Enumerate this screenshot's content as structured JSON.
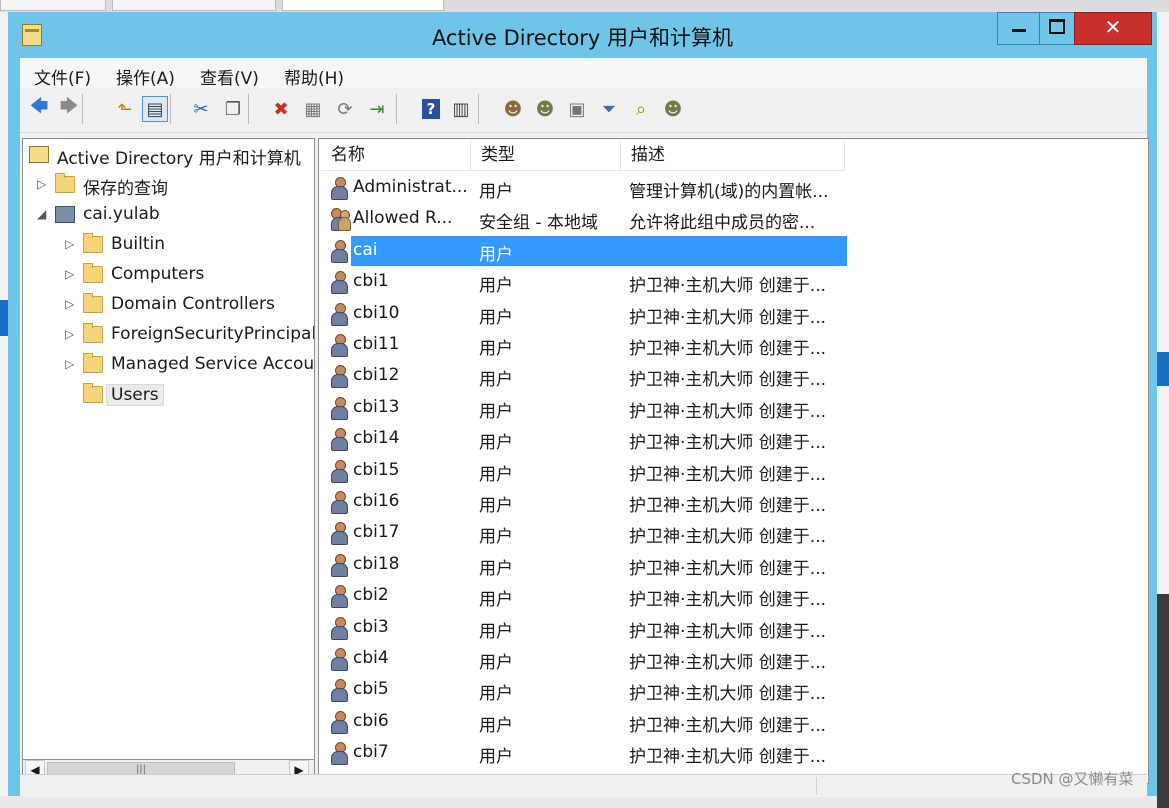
{
  "window": {
    "title": "Active Directory 用户和计算机"
  },
  "menu": [
    "文件(F)",
    "操作(A)",
    "查看(V)",
    "帮助(H)"
  ],
  "toolbar": [
    {
      "icon": "back-arrow-icon",
      "glyph": "🡄",
      "color": "#2f7ad6"
    },
    {
      "icon": "forward-arrow-icon",
      "glyph": "🡆",
      "color": "#8a8a8a"
    },
    {
      "icon": "up-folder-icon",
      "glyph": "⬑",
      "color": "#b58a1b"
    },
    {
      "icon": "show-hide-console-tree-icon",
      "glyph": "▤",
      "color": "#444"
    },
    {
      "icon": "cut-icon",
      "glyph": "✂",
      "color": "#2d5fa8"
    },
    {
      "icon": "copy-icon",
      "glyph": "❐",
      "color": "#555"
    },
    {
      "icon": "delete-icon",
      "glyph": "✖",
      "color": "#d12b1f"
    },
    {
      "icon": "properties-icon",
      "glyph": "▦",
      "color": "#777"
    },
    {
      "icon": "refresh-icon",
      "glyph": "⟳",
      "color": "#777"
    },
    {
      "icon": "export-list-icon",
      "glyph": "⇥",
      "color": "#3a8a2e"
    },
    {
      "icon": "help-icon",
      "glyph": "?",
      "color": "#2b4fa0"
    },
    {
      "icon": "action-pane-icon",
      "glyph": "▥",
      "color": "#444"
    },
    {
      "icon": "new-user-icon",
      "glyph": "☻",
      "color": "#8a6a3a"
    },
    {
      "icon": "new-group-icon",
      "glyph": "☻",
      "color": "#6c7d48"
    },
    {
      "icon": "new-ou-icon",
      "glyph": "▣",
      "color": "#777"
    },
    {
      "icon": "filter-icon",
      "glyph": "⏷",
      "color": "#3a6ea5"
    },
    {
      "icon": "find-icon",
      "glyph": "⌕",
      "color": "#b58a1b"
    },
    {
      "icon": "add-to-group-icon",
      "glyph": "☻",
      "color": "#6c7d48"
    }
  ],
  "tree": [
    {
      "label": "Active Directory 用户和计算机",
      "level": 0,
      "expander": "",
      "icon": "ad-root-icon"
    },
    {
      "label": "保存的查询",
      "level": 1,
      "expander": "▷",
      "icon": "folder-icon"
    },
    {
      "label": "cai.yulab",
      "level": 1,
      "expander": "◢",
      "icon": "domain-icon"
    },
    {
      "label": "Builtin",
      "level": 2,
      "expander": "▷",
      "icon": "folder-icon"
    },
    {
      "label": "Computers",
      "level": 2,
      "expander": "▷",
      "icon": "folder-icon"
    },
    {
      "label": "Domain Controllers",
      "level": 2,
      "expander": "▷",
      "icon": "folder-icon"
    },
    {
      "label": "ForeignSecurityPrincipals",
      "level": 2,
      "expander": "▷",
      "icon": "folder-icon"
    },
    {
      "label": "Managed Service Accounts",
      "level": 2,
      "expander": "▷",
      "icon": "folder-icon"
    },
    {
      "label": "Users",
      "level": 2,
      "expander": "",
      "icon": "folder-icon",
      "selected": true
    }
  ],
  "list": {
    "columns": [
      "名称",
      "类型",
      "描述"
    ],
    "rows": [
      {
        "name": "Administrat...",
        "type": "用户",
        "desc": "管理计算机(域)的内置帐...",
        "icon": "user-icon"
      },
      {
        "name": "Allowed R...",
        "type": "安全组 - 本地域",
        "desc": "允许将此组中成员的密...",
        "icon": "group-icon"
      },
      {
        "name": "cai",
        "type": "用户",
        "desc": "",
        "icon": "user-icon",
        "selected": true
      },
      {
        "name": "cbi1",
        "type": "用户",
        "desc": "护卫神·主机大师 创建于...",
        "icon": "user-icon"
      },
      {
        "name": "cbi10",
        "type": "用户",
        "desc": "护卫神·主机大师 创建于...",
        "icon": "user-icon"
      },
      {
        "name": "cbi11",
        "type": "用户",
        "desc": "护卫神·主机大师 创建于...",
        "icon": "user-icon"
      },
      {
        "name": "cbi12",
        "type": "用户",
        "desc": "护卫神·主机大师 创建于...",
        "icon": "user-icon"
      },
      {
        "name": "cbi13",
        "type": "用户",
        "desc": "护卫神·主机大师 创建于...",
        "icon": "user-icon"
      },
      {
        "name": "cbi14",
        "type": "用户",
        "desc": "护卫神·主机大师 创建于...",
        "icon": "user-icon"
      },
      {
        "name": "cbi15",
        "type": "用户",
        "desc": "护卫神·主机大师 创建于...",
        "icon": "user-icon"
      },
      {
        "name": "cbi16",
        "type": "用户",
        "desc": "护卫神·主机大师 创建于...",
        "icon": "user-icon"
      },
      {
        "name": "cbi17",
        "type": "用户",
        "desc": "护卫神·主机大师 创建于...",
        "icon": "user-icon"
      },
      {
        "name": "cbi18",
        "type": "用户",
        "desc": "护卫神·主机大师 创建于...",
        "icon": "user-icon"
      },
      {
        "name": "cbi2",
        "type": "用户",
        "desc": "护卫神·主机大师 创建于...",
        "icon": "user-icon"
      },
      {
        "name": "cbi3",
        "type": "用户",
        "desc": "护卫神·主机大师 创建于...",
        "icon": "user-icon"
      },
      {
        "name": "cbi4",
        "type": "用户",
        "desc": "护卫神·主机大师 创建于...",
        "icon": "user-icon"
      },
      {
        "name": "cbi5",
        "type": "用户",
        "desc": "护卫神·主机大师 创建于...",
        "icon": "user-icon"
      },
      {
        "name": "cbi6",
        "type": "用户",
        "desc": "护卫神·主机大师 创建于...",
        "icon": "user-icon"
      },
      {
        "name": "cbi7",
        "type": "用户",
        "desc": "护卫神·主机大师 创建于...",
        "icon": "user-icon"
      }
    ]
  },
  "colors": {
    "titlebar": "#6ec5e8",
    "selection": "#3399ff",
    "close_button": "#c9302c"
  },
  "watermark": "CSDN @又懒有菜"
}
